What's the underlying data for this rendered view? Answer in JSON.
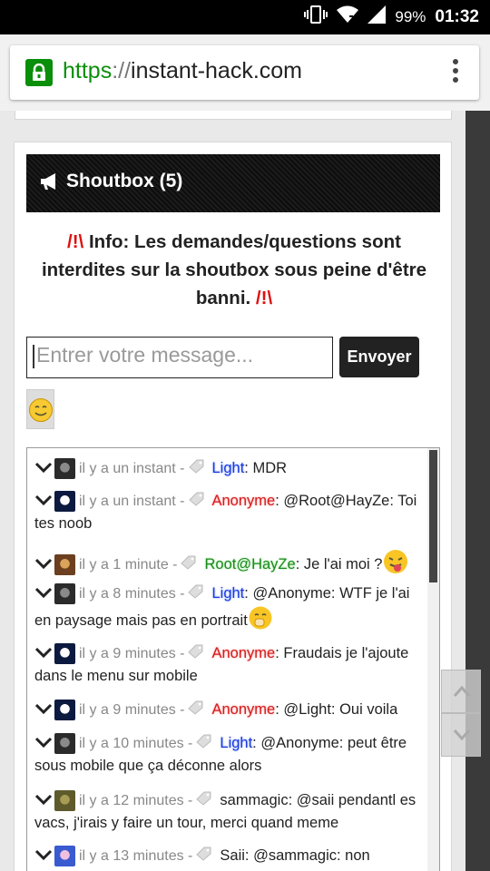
{
  "status_bar": {
    "battery": "99%",
    "time": "01:32"
  },
  "browser": {
    "url_protocol": "https",
    "url_separator": "://",
    "url_host": "instant-hack.com"
  },
  "shoutbox": {
    "title": "Shoutbox (5)",
    "info_warn": "/!\\",
    "info_text": "Info: Les demandes/questions sont interdites sur la shoutbox sous peine d'être banni.",
    "input_placeholder": "Entrer votre message...",
    "send_label": "Envoyer",
    "messages": [
      {
        "time": "il y a un instant -",
        "user": "Light",
        "sep": ":",
        "text": " MDR",
        "avatar": "dark"
      },
      {
        "time": "il y a un instant -",
        "user": "Anonyme",
        "sep": ":",
        "text": " @Root@HayZe: Toi tes noob",
        "avatar": "anon"
      },
      {
        "time": "il y a 1 minute -",
        "user": "Root@HayZe",
        "sep": ":",
        "text": " Je l'ai moi ?",
        "avatar": "root"
      },
      {
        "time": "il y a 8 minutes -",
        "user": "Light",
        "sep": ":",
        "text": " @Anonyme: WTF je l'ai en paysage mais pas en portrait",
        "avatar": "dark"
      },
      {
        "time": "il y a 9 minutes -",
        "user": "Anonyme",
        "sep": ":",
        "text": " Fraudais je l'ajoute dans le menu sur mobile",
        "avatar": "anon"
      },
      {
        "time": "il y a 9 minutes -",
        "user": "Anonyme",
        "sep": ":",
        "text": " @Light: Oui voila",
        "avatar": "anon"
      },
      {
        "time": "il y a 10 minutes -",
        "user": "Light",
        "sep": ":",
        "text": " @Anonyme: peut être sous mobile que ça déconne alors",
        "avatar": "dark"
      },
      {
        "time": "il y a 12 minutes -",
        "user": "sammagic",
        "sep": ":",
        "text": " @saii pendantl es vacs, j'irais y faire un tour, merci quand meme",
        "avatar": "sam"
      },
      {
        "time": "il y a 13 minutes -",
        "user": "Saii",
        "sep": ":",
        "text": " @sammagic: non",
        "avatar": "saii"
      }
    ]
  }
}
